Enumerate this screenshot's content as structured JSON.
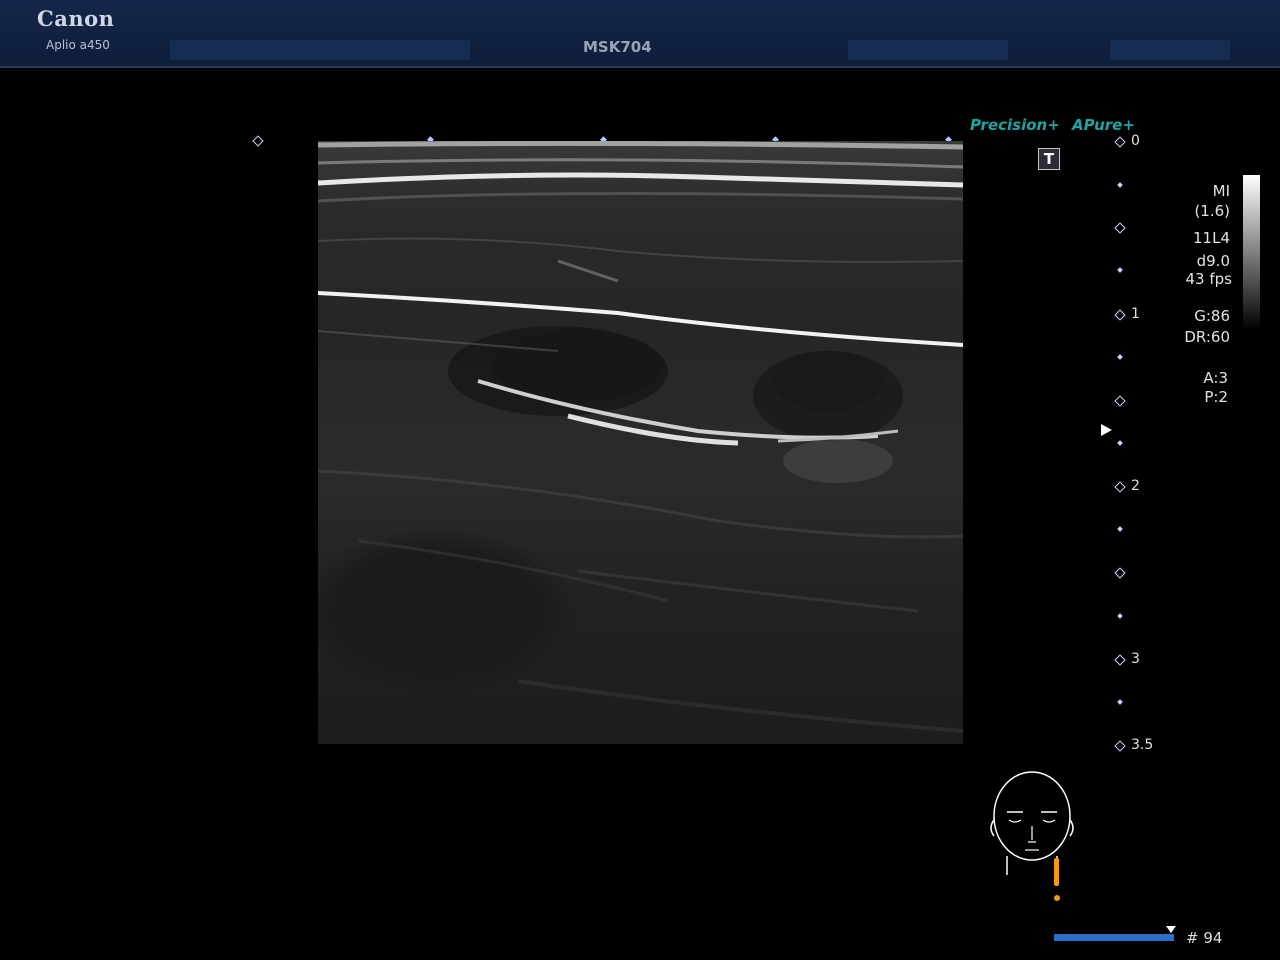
{
  "header": {
    "brand": "Canon",
    "model": "Aplio a450",
    "preset": "MSK704"
  },
  "badges": {
    "precision": "Precision+",
    "apure": "APure+",
    "t_icon": "T"
  },
  "depth_scale": {
    "labels": [
      "0",
      "1",
      "2",
      "3",
      "3.5"
    ]
  },
  "params": {
    "mi_label": "MI",
    "mi_value": "(1.6)",
    "probe": "11L4",
    "depth": "d9.0",
    "fps": "43 fps",
    "gain": "G:86",
    "dynamic_range": "DR:60",
    "a": "A:3",
    "p": "P:2"
  },
  "frame": {
    "label": "# 94"
  },
  "colors": {
    "accent_teal": "#1fa3a3",
    "header_bg": "#14274a",
    "frame_bar": "#2d6ec9",
    "bodymark_probe": "#f39c12"
  },
  "icons": {
    "focus": "focus-arrow-icon",
    "body_mark": "head-bodymark-icon"
  }
}
